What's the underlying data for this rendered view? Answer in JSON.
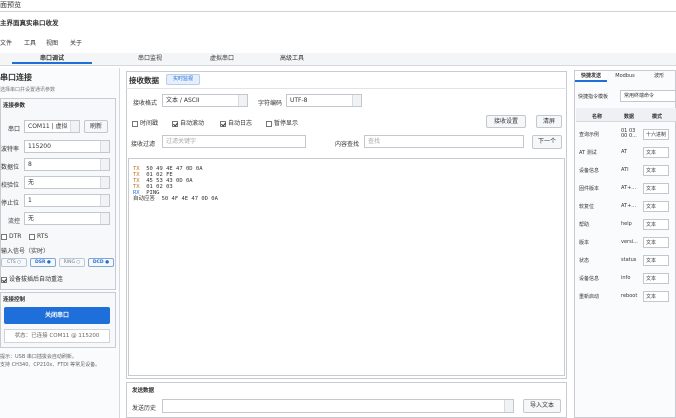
{
  "window": {
    "title_top": "面预览",
    "title_main": "主界面真实串口收发"
  },
  "menu": [
    "文件",
    "工具",
    "视图",
    "关于"
  ],
  "tabs": [
    {
      "label": "串口调试",
      "active": true
    },
    {
      "label": "串口监视",
      "active": false
    },
    {
      "label": "虚拟串口",
      "active": false
    },
    {
      "label": "高级工具",
      "active": false
    }
  ],
  "left": {
    "heading": "串口连接",
    "subheading": "选择串口并设置通讯参数",
    "params_title": "连接参数",
    "fields": [
      {
        "label": "串口",
        "value": "COM11 | 虚拟"
      },
      {
        "label": "波特率",
        "value": "115200"
      },
      {
        "label": "数据位",
        "value": "8"
      },
      {
        "label": "校验位",
        "value": "无"
      },
      {
        "label": "停止位",
        "value": "1"
      },
      {
        "label": "流控",
        "value": "无"
      }
    ],
    "refresh_label": "刷新",
    "dtr_label": "DTR",
    "rts_label": "RTS",
    "input_signals_label": "输入信号（实时）",
    "signals": [
      "CTS ○",
      "DSR ●",
      "RING ○",
      "DCD ●"
    ],
    "auto_reconnect_label": "设备拔插后自动重连",
    "control_title": "连接控制",
    "close_button": "关闭串口",
    "status_text": "状态：已连接 COM11 @ 115200",
    "tip_line1": "提示：USB 串口插拔会自动刷新。",
    "tip_line2": "支持 CH340、CP210x、FTDI 等常见设备。"
  },
  "receive": {
    "title": "接收数据",
    "live_badge": "实时监视",
    "format_label": "接收格式",
    "format_value": "文本 / ASCII",
    "encoding_label": "字符编码",
    "encoding_value": "UTF-8",
    "cb_timestamp": "时间戳",
    "cb_autoscroll": "自动滚动",
    "cb_autolog": "自动日志",
    "cb_pause": "暂停显示",
    "settings_button": "接收设置",
    "clear_button": "清屏",
    "filter_label": "接收过滤",
    "filter_placeholder": "过滤关键字",
    "search_label": "内容查找",
    "search_placeholder": "查找",
    "next_button": "下一个",
    "log": [
      {
        "dir": "TX",
        "text": "  50 49 4E 47 0D 0A"
      },
      {
        "dir": "TX",
        "text": "  01 02 FE"
      },
      {
        "dir": "TX",
        "text": "  45 53 43 0D 0A"
      },
      {
        "dir": "TX",
        "text": "  01 02 03"
      },
      {
        "dir": "RX",
        "text": "  PING"
      },
      {
        "dir": "",
        "text": "自动应答  50 4F 4E 47 0D 0A"
      }
    ]
  },
  "send": {
    "title": "发送数据",
    "history_label": "发送历史",
    "import_button": "导入文本"
  },
  "right": {
    "tabs": [
      "快捷发送",
      "Modbus",
      "波形"
    ],
    "template_label": "快捷指令模板",
    "template_value": "常用终端命令",
    "headers": [
      "名称",
      "数据",
      "模式"
    ],
    "rows": [
      {
        "name": "查询示例",
        "data": "01 03\n00 0...",
        "mode": "十六进制"
      },
      {
        "name": "AT 测试",
        "data": "AT",
        "mode": "文本"
      },
      {
        "name": "设备信息",
        "data": "ATI",
        "mode": "文本"
      },
      {
        "name": "固件版本",
        "data": "AT+...",
        "mode": "文本"
      },
      {
        "name": "软复位",
        "data": "AT+...",
        "mode": "文本"
      },
      {
        "name": "帮助",
        "data": "help",
        "mode": "文本"
      },
      {
        "name": "版本",
        "data": "versi...",
        "mode": "文本"
      },
      {
        "name": "状态",
        "data": "status",
        "mode": "文本"
      },
      {
        "name": "设备信息",
        "data": "info",
        "mode": "文本"
      },
      {
        "name": "重新启动",
        "data": "reboot",
        "mode": "文本"
      }
    ]
  },
  "colors": {
    "accent": "#1e6fd9",
    "tx": "#c0711b",
    "rx": "#1e6fd9"
  }
}
